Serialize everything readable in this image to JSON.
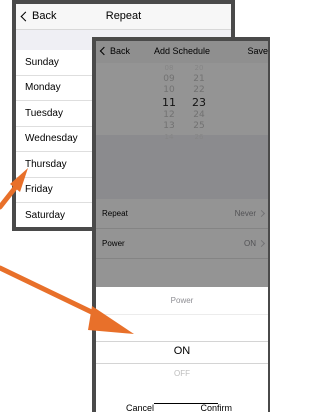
{
  "repeat_screen": {
    "back_label": "Back",
    "title": "Repeat",
    "days": [
      "Sunday",
      "Monday",
      "Tuesday",
      "Wednesday",
      "Thursday",
      "Friday",
      "Saturday"
    ]
  },
  "add_schedule": {
    "back_label": "Back",
    "title": "Add Schedule",
    "save_label": "Save",
    "time_picker": {
      "hours": [
        "08",
        "09",
        "10",
        "11",
        "12",
        "13",
        "14"
      ],
      "minutes": [
        "20",
        "21",
        "22",
        "23",
        "24",
        "25",
        "26"
      ],
      "selected_hour": "11",
      "selected_minute": "23"
    },
    "settings": [
      {
        "label": "Repeat",
        "value": "Never"
      },
      {
        "label": "Power",
        "value": "ON"
      }
    ],
    "power_sheet": {
      "title": "Power",
      "options": [
        "ON",
        "OFF"
      ],
      "selected": "ON",
      "cancel_label": "Cancel",
      "confirm_label": "Confirm"
    }
  },
  "colors": {
    "arrow": "#e8702a",
    "frame": "#4a4a4a",
    "overlay": "rgba(0,0,0,0.42)"
  }
}
